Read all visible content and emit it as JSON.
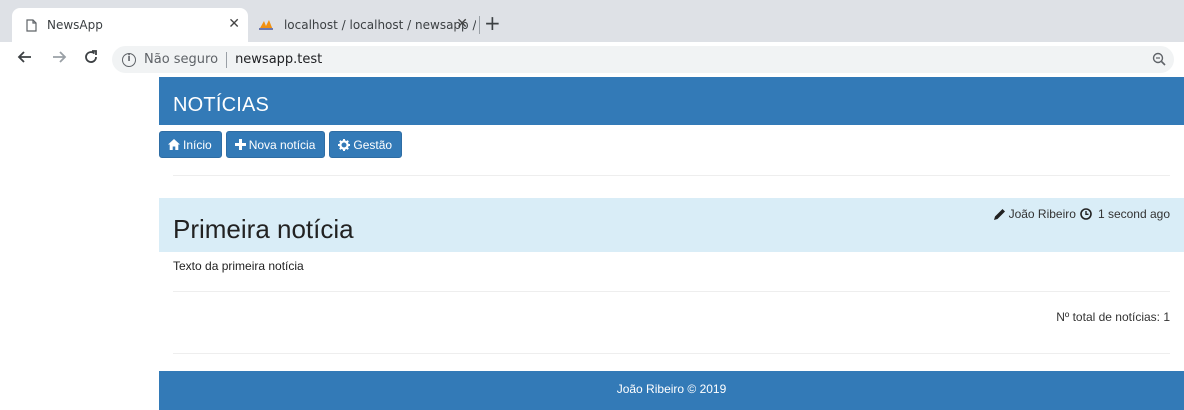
{
  "browser": {
    "tabs": [
      {
        "title": "NewsApp",
        "icon": "page-icon"
      },
      {
        "title": "localhost / localhost / newsapp / ",
        "icon": "phpmyadmin-icon"
      }
    ],
    "close_glyph": "✕",
    "new_tab_glyph": "+",
    "security_label": "Não seguro",
    "url": "newsapp.test"
  },
  "app": {
    "title": "NOTÍCIAS",
    "menu": [
      {
        "label": "Início",
        "icon": "home-icon"
      },
      {
        "label": "Nova notícia",
        "icon": "plus-icon"
      },
      {
        "label": "Gestão",
        "icon": "gear-icon"
      }
    ],
    "accent_color": "#337ab7",
    "news_header_color": "#d9edf7"
  },
  "news": [
    {
      "title": "Primeira notícia",
      "author": "João Ribeiro",
      "time": "1 second ago",
      "body": "Texto da primeira notícia"
    }
  ],
  "total_label": "Nº total de notícias: 1",
  "footer": {
    "text": "João Ribeiro © 2019"
  }
}
